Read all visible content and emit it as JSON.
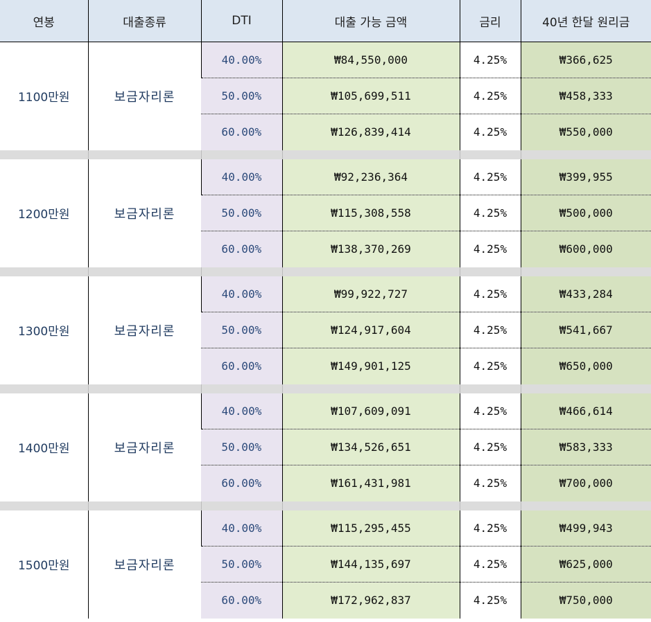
{
  "headers": {
    "salary": "연봉",
    "loan_type": "대출종류",
    "dti": "DTI",
    "loan_amount": "대출 가능 금액",
    "interest": "금리",
    "monthly_payment": "40년 한달 원리금"
  },
  "groups": [
    {
      "salary": "1100만원",
      "loan_type": "보금자리론",
      "rows": [
        {
          "dti": "40.00%",
          "amount": "₩84,550,000",
          "interest": "4.25%",
          "payment": "₩366,625"
        },
        {
          "dti": "50.00%",
          "amount": "₩105,699,511",
          "interest": "4.25%",
          "payment": "₩458,333"
        },
        {
          "dti": "60.00%",
          "amount": "₩126,839,414",
          "interest": "4.25%",
          "payment": "₩550,000"
        }
      ]
    },
    {
      "salary": "1200만원",
      "loan_type": "보금자리론",
      "rows": [
        {
          "dti": "40.00%",
          "amount": "₩92,236,364",
          "interest": "4.25%",
          "payment": "₩399,955"
        },
        {
          "dti": "50.00%",
          "amount": "₩115,308,558",
          "interest": "4.25%",
          "payment": "₩500,000"
        },
        {
          "dti": "60.00%",
          "amount": "₩138,370,269",
          "interest": "4.25%",
          "payment": "₩600,000"
        }
      ]
    },
    {
      "salary": "1300만원",
      "loan_type": "보금자리론",
      "rows": [
        {
          "dti": "40.00%",
          "amount": "₩99,922,727",
          "interest": "4.25%",
          "payment": "₩433,284"
        },
        {
          "dti": "50.00%",
          "amount": "₩124,917,604",
          "interest": "4.25%",
          "payment": "₩541,667"
        },
        {
          "dti": "60.00%",
          "amount": "₩149,901,125",
          "interest": "4.25%",
          "payment": "₩650,000"
        }
      ]
    },
    {
      "salary": "1400만원",
      "loan_type": "보금자리론",
      "rows": [
        {
          "dti": "40.00%",
          "amount": "₩107,609,091",
          "interest": "4.25%",
          "payment": "₩466,614"
        },
        {
          "dti": "50.00%",
          "amount": "₩134,526,651",
          "interest": "4.25%",
          "payment": "₩583,333"
        },
        {
          "dti": "60.00%",
          "amount": "₩161,431,981",
          "interest": "4.25%",
          "payment": "₩700,000"
        }
      ]
    },
    {
      "salary": "1500만원",
      "loan_type": "보금자리론",
      "rows": [
        {
          "dti": "40.00%",
          "amount": "₩115,295,455",
          "interest": "4.25%",
          "payment": "₩499,943"
        },
        {
          "dti": "50.00%",
          "amount": "₩144,135,697",
          "interest": "4.25%",
          "payment": "₩625,000"
        },
        {
          "dti": "60.00%",
          "amount": "₩172,962,837",
          "interest": "4.25%",
          "payment": "₩750,000"
        }
      ]
    }
  ]
}
